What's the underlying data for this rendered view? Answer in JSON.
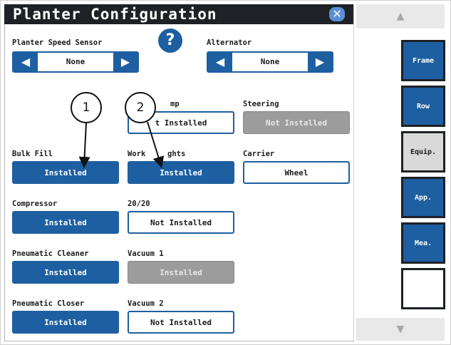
{
  "window": {
    "title": "Planter Configuration",
    "close_glyph": "✕"
  },
  "help": {
    "glyph": "?",
    "icon": "help-icon"
  },
  "speed_sensor": {
    "label": "Planter Speed Sensor",
    "value": "None"
  },
  "alternator": {
    "label": "Alternator",
    "value": "None"
  },
  "arrows": {
    "left": "◀",
    "right": "▶"
  },
  "rows": {
    "pump": {
      "label": "mp",
      "value": "t Installed",
      "state": "not-installed"
    },
    "steering": {
      "label": "Steering",
      "value": "Not Installed",
      "state": "disabled"
    },
    "bulk_fill": {
      "label": "Bulk Fill",
      "value": "Installed",
      "state": "installed"
    },
    "work_lights": {
      "label_a": "Work",
      "label_b": "ghts",
      "value": "Installed",
      "state": "installed"
    },
    "carrier": {
      "label": "Carrier",
      "value": "Wheel",
      "state": "not-installed"
    },
    "compressor": {
      "label": "Compressor",
      "value": "Installed",
      "state": "installed"
    },
    "twenty_twenty": {
      "label": "20/20",
      "value": "Not Installed",
      "state": "not-installed"
    },
    "pneumatic_cleaner": {
      "label": "Pneumatic Cleaner",
      "value": "Installed",
      "state": "installed"
    },
    "vacuum1": {
      "label": "Vacuum 1",
      "value": "Installed",
      "state": "disabled"
    },
    "pneumatic_closer": {
      "label": "Pneumatic Closer",
      "value": "Installed",
      "state": "installed"
    },
    "vacuum2": {
      "label": "Vacuum 2",
      "value": "Not Installed",
      "state": "not-installed"
    }
  },
  "sidebar": {
    "scroll_up": "▲",
    "scroll_down": "▼",
    "items": [
      {
        "label": "Frame",
        "state": "inactive"
      },
      {
        "label": "Row",
        "state": "inactive"
      },
      {
        "label": "Equip.",
        "state": "active"
      },
      {
        "label": "App.",
        "state": "inactive"
      },
      {
        "label": "Mea.",
        "state": "inactive"
      },
      {
        "label": "",
        "state": "blank"
      }
    ]
  },
  "callouts": [
    "1",
    "2"
  ]
}
